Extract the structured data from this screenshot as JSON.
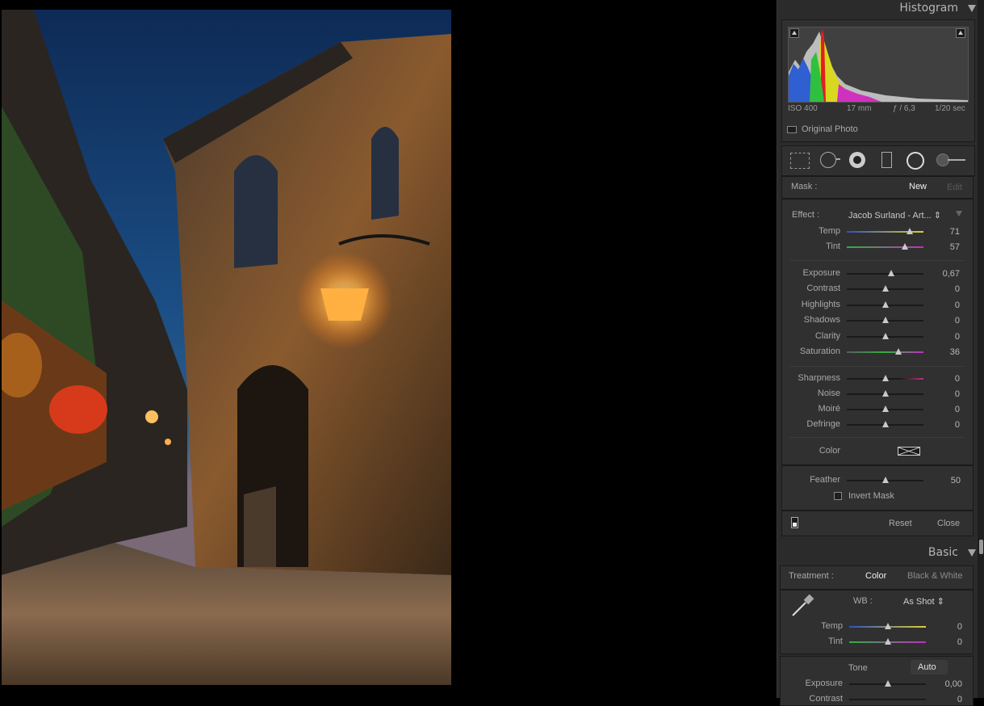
{
  "histogram": {
    "title": "Histogram",
    "iso": "ISO 400",
    "focal": "17 mm",
    "aperture": "ƒ / 6,3",
    "shutter": "1/20 sec",
    "original_photo": "Original Photo"
  },
  "mask_panel": {
    "mask_label": "Mask :",
    "new_label": "New",
    "edit_label": "Edit",
    "effect_label": "Effect :",
    "effect_value": "Jacob Surland - Art... ⇕",
    "sliders_wb": [
      {
        "label": "Temp",
        "value": "71",
        "pos": 0.82
      },
      {
        "label": "Tint",
        "value": "57",
        "pos": 0.76
      }
    ],
    "sliders_tone": [
      {
        "label": "Exposure",
        "value": "0,67",
        "pos": 0.58
      },
      {
        "label": "Contrast",
        "value": "0",
        "pos": 0.5
      },
      {
        "label": "Highlights",
        "value": "0",
        "pos": 0.5
      },
      {
        "label": "Shadows",
        "value": "0",
        "pos": 0.5
      },
      {
        "label": "Clarity",
        "value": "0",
        "pos": 0.5
      },
      {
        "label": "Saturation",
        "value": "36",
        "pos": 0.67
      }
    ],
    "sliders_detail": [
      {
        "label": "Sharpness",
        "value": "0",
        "pos": 0.5
      },
      {
        "label": "Noise",
        "value": "0",
        "pos": 0.5
      },
      {
        "label": "Moiré",
        "value": "0",
        "pos": 0.5
      },
      {
        "label": "Defringe",
        "value": "0",
        "pos": 0.5
      }
    ],
    "color_label": "Color",
    "feather_label": "Feather",
    "feather_value": "50",
    "feather_pos": 0.5,
    "invert_mask": "Invert Mask",
    "reset": "Reset",
    "close": "Close"
  },
  "basic": {
    "title": "Basic",
    "treatment_label": "Treatment :",
    "color": "Color",
    "bw": "Black & White",
    "wb_label": "WB :",
    "wb_value": "As Shot ⇕",
    "temp_label": "Temp",
    "temp_value": "0",
    "tint_label": "Tint",
    "tint_value": "0",
    "tone_label": "Tone",
    "auto_label": "Auto",
    "exposure_label": "Exposure",
    "exposure_value": "0,00",
    "contrast_label": "Contrast",
    "contrast_value": "0"
  }
}
